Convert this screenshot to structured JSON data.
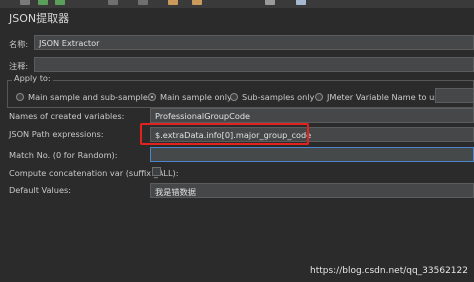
{
  "panel": {
    "title": "JSON提取器"
  },
  "fields": {
    "name_label": "名称:",
    "name_value": "JSON Extractor",
    "comment_label": "注释:",
    "comment_value": ""
  },
  "apply_to": {
    "legend": "Apply to:",
    "options": [
      "Main sample and sub-samples",
      "Main sample only",
      "Sub-samples only",
      "JMeter Variable Name to use"
    ],
    "selected": "Main sample only"
  },
  "extractor": {
    "variables_label": "Names of created variables:",
    "variables_value": "ProfessionalGroupCode",
    "json_path_label": "JSON Path expressions:",
    "json_path_value": "$.extraData.info[0].major_group_code",
    "match_no_label": "Match No. (0 for Random):",
    "match_no_value": "",
    "concat_label": "Compute concatenation var (suffix _ALL):",
    "default_label": "Default Values:",
    "default_value": "我是错数据"
  },
  "watermark": "https://blog.csdn.net/qq_33562122",
  "colors": {
    "background": "#2b2b2b",
    "field_background": "#454749",
    "highlight_box": "#e3221e",
    "focus_border": "#4b86cc"
  },
  "toolbar_icons": [
    "run-icon",
    "run-icon-green",
    "stop-icon",
    "clear-icon",
    "template-icon",
    "broom-icon",
    "search-icon",
    "tree-icon",
    "help-icon"
  ]
}
